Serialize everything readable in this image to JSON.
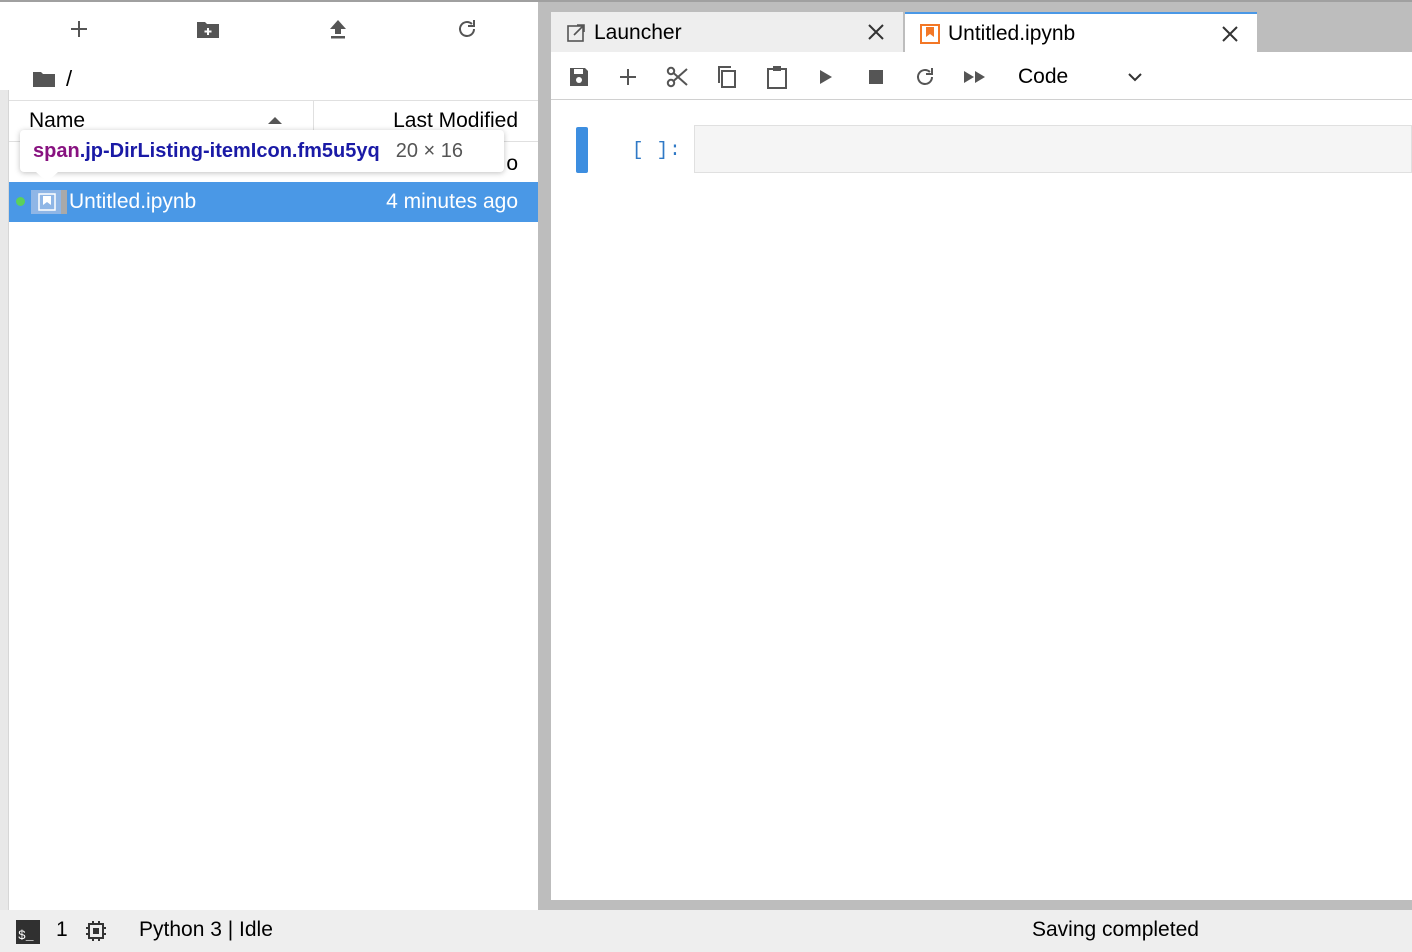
{
  "file_browser": {
    "toolbar": {
      "new_launcher_icon": "plus-icon",
      "new_folder_icon": "new-folder-icon",
      "upload_icon": "upload-icon",
      "refresh_icon": "refresh-icon"
    },
    "breadcrumb": {
      "root": "/"
    },
    "header": {
      "name": "Name",
      "last_modified": "Last Modified",
      "sort": "ascending"
    },
    "hidden_row_fragment": "o",
    "items": [
      {
        "name": "Untitled.ipynb",
        "last_modified": "4 minutes ago",
        "selected": true,
        "running": true
      }
    ]
  },
  "inspector_tooltip": {
    "tag": "span",
    "selector": ".jp-DirListing-itemIcon.fm5u5yq",
    "dimensions": "20 × 16"
  },
  "tabs": [
    {
      "label": "Launcher",
      "icon": "launch-icon",
      "current": false
    },
    {
      "label": "Untitled.ipynb",
      "icon": "notebook-icon",
      "current": true
    }
  ],
  "notebook_toolbar": {
    "cell_type": "Code",
    "buttons": [
      "save",
      "insert",
      "cut",
      "copy",
      "paste",
      "run",
      "interrupt",
      "restart",
      "restart-run-all"
    ]
  },
  "cells": [
    {
      "prompt": "[ ]:",
      "source": ""
    }
  ],
  "status_bar": {
    "terminals": "1",
    "kernel": "Python 3 | Idle",
    "message": "Saving completed"
  },
  "colors": {
    "accent": "#4a98e6",
    "selected_row": "#4a98e6",
    "notebook_icon": "#f37726",
    "running_dot": "#5bd15b"
  }
}
